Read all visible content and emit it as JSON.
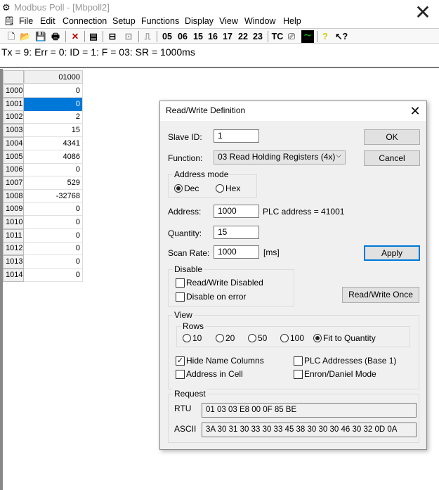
{
  "window": {
    "title": "Modbus Poll - [Mbpoll2]",
    "close": "✕"
  },
  "menu": [
    "File",
    "Edit",
    "Connection",
    "Setup",
    "Functions",
    "Display",
    "View",
    "Window",
    "Help"
  ],
  "toolbar": {
    "function_codes": [
      "05",
      "06",
      "15",
      "16",
      "17",
      "22",
      "23"
    ],
    "tc": "TC"
  },
  "status": "Tx = 9: Err = 0: ID = 1: F = 03: SR = 1000ms",
  "grid": {
    "column": "01000",
    "selected_row": "1001",
    "rows": [
      {
        "addr": "1000",
        "value": "0"
      },
      {
        "addr": "1001",
        "value": "0"
      },
      {
        "addr": "1002",
        "value": "2"
      },
      {
        "addr": "1003",
        "value": "15"
      },
      {
        "addr": "1004",
        "value": "4341"
      },
      {
        "addr": "1005",
        "value": "4086"
      },
      {
        "addr": "1006",
        "value": "0"
      },
      {
        "addr": "1007",
        "value": "529"
      },
      {
        "addr": "1008",
        "value": "-32768"
      },
      {
        "addr": "1009",
        "value": "0"
      },
      {
        "addr": "1010",
        "value": "0"
      },
      {
        "addr": "1011",
        "value": "0"
      },
      {
        "addr": "1012",
        "value": "0"
      },
      {
        "addr": "1013",
        "value": "0"
      },
      {
        "addr": "1014",
        "value": "0"
      }
    ]
  },
  "dialog": {
    "title": "Read/Write Definition",
    "slave_id_label": "Slave ID:",
    "slave_id": "1",
    "function_label": "Function:",
    "function": "03 Read Holding Registers (4x)",
    "address_mode": {
      "label": "Address mode",
      "dec": "Dec",
      "hex": "Hex",
      "selected": "Dec"
    },
    "address_label": "Address:",
    "address": "1000",
    "plc_address": "PLC address = 41001",
    "quantity_label": "Quantity:",
    "quantity": "15",
    "scan_rate_label": "Scan Rate:",
    "scan_rate": "1000",
    "scan_unit": "[ms]",
    "ok": "OK",
    "cancel": "Cancel",
    "apply": "Apply",
    "rw_once": "Read/Write Once",
    "disable": {
      "label": "Disable",
      "rw_disabled": "Read/Write Disabled",
      "rw_disabled_checked": false,
      "on_error": "Disable on error",
      "on_error_checked": false
    },
    "view": {
      "label": "View",
      "rows_label": "Rows",
      "rows_options": [
        "10",
        "20",
        "50",
        "100",
        "Fit to Quantity"
      ],
      "rows_selected": "Fit to Quantity",
      "hide_name": "Hide Name Columns",
      "hide_name_checked": true,
      "plc_base1": "PLC Addresses (Base 1)",
      "plc_base1_checked": false,
      "addr_in_cell": "Address in Cell",
      "addr_in_cell_checked": false,
      "enron": "Enron/Daniel Mode",
      "enron_checked": false
    },
    "request": {
      "label": "Request",
      "rtu_label": "RTU",
      "rtu": "01 03 03 E8 00 0F 85 BE",
      "ascii_label": "ASCII",
      "ascii": "3A 30 31 30 33 30 33 45 38 30 30 30 46 30 32 0D 0A"
    }
  }
}
